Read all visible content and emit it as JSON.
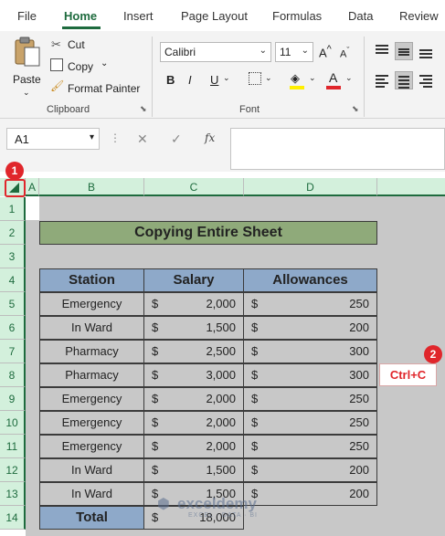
{
  "ribbon_tabs": [
    "File",
    "Home",
    "Insert",
    "Page Layout",
    "Formulas",
    "Data",
    "Review"
  ],
  "clipboard": {
    "paste": "Paste",
    "cut": "Cut",
    "copy": "Copy",
    "format_painter": "Format Painter",
    "group_label": "Clipboard"
  },
  "font": {
    "name": "Calibri",
    "size": "11",
    "group_label": "Font",
    "bold": "B",
    "italic": "I",
    "underline": "U",
    "font_color": "A",
    "fx": "fx"
  },
  "formula_bar": {
    "name_box": "A1"
  },
  "columns": [
    "A",
    "B",
    "C",
    "D"
  ],
  "rows": [
    "1",
    "2",
    "3",
    "4",
    "5",
    "6",
    "7",
    "8",
    "9",
    "10",
    "11",
    "12",
    "13",
    "14"
  ],
  "sheet": {
    "title": "Copying Entire Sheet",
    "headers": [
      "Station",
      "Salary",
      "Allowances"
    ],
    "data": [
      {
        "station": "Emergency",
        "salary": "2,000",
        "allowance": "250"
      },
      {
        "station": "In Ward",
        "salary": "1,500",
        "allowance": "200"
      },
      {
        "station": "Pharmacy",
        "salary": "2,500",
        "allowance": "300"
      },
      {
        "station": "Pharmacy",
        "salary": "3,000",
        "allowance": "300"
      },
      {
        "station": "Emergency",
        "salary": "2,000",
        "allowance": "250"
      },
      {
        "station": "Emergency",
        "salary": "2,000",
        "allowance": "250"
      },
      {
        "station": "Emergency",
        "salary": "2,000",
        "allowance": "250"
      },
      {
        "station": "In Ward",
        "salary": "1,500",
        "allowance": "200"
      },
      {
        "station": "In Ward",
        "salary": "1,500",
        "allowance": "200"
      }
    ],
    "total_label": "Total",
    "total_salary": "18,000",
    "currency": "$"
  },
  "annotations": {
    "badge1": "1",
    "badge2": "2",
    "shortcut": "Ctrl+C"
  },
  "watermark": "exceldemy",
  "watermark_sub": "EXCEL · DATA · BI",
  "colors": {
    "accent": "#1e6b3e",
    "title_fill": "#8faa7a",
    "header_fill": "#8ea9c9",
    "badge": "#e0262b"
  }
}
